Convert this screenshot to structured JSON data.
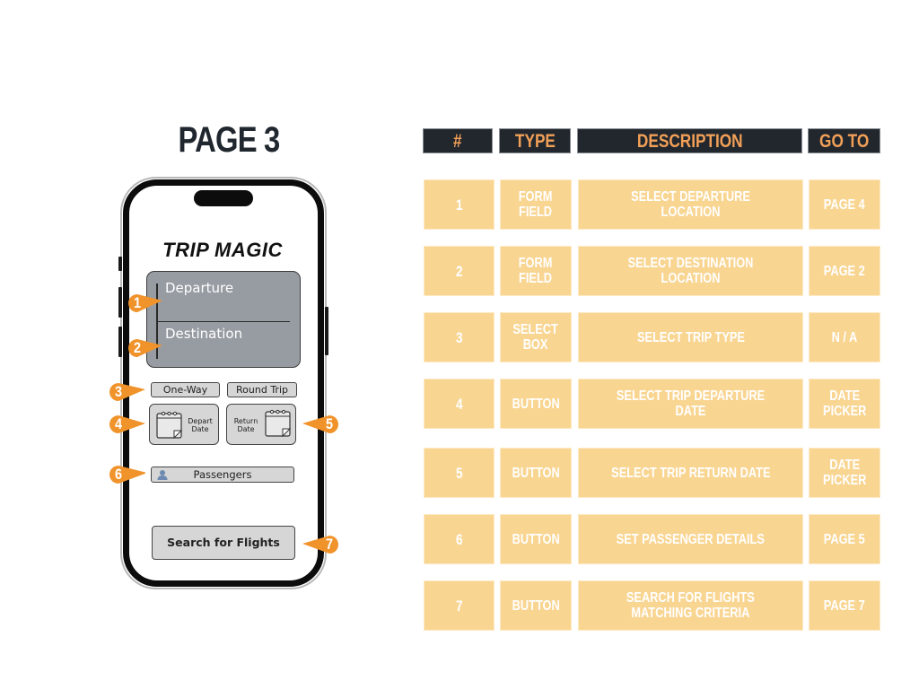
{
  "page_title": "PAGE 3",
  "phone": {
    "app_title": "TRIP MAGIC",
    "departure_label": "Departure",
    "destination_label": "Destination",
    "one_way_label": "One-Way",
    "round_trip_label": "Round Trip",
    "depart_date_label": "Depart\nDate",
    "return_date_label": "Return\nDate",
    "passengers_label": "Passengers",
    "search_label": "Search for Flights"
  },
  "markers": [
    "1",
    "2",
    "3",
    "4",
    "5",
    "6",
    "7"
  ],
  "colors": {
    "marker_orange": "#f0932b",
    "header_bg": "#22272e",
    "header_text": "#f2a057",
    "row_bg": "#f9d592",
    "panel_gray": "#979ca3"
  },
  "table": {
    "headers": [
      "#",
      "TYPE",
      "DESCRIPTION",
      "GO TO"
    ],
    "rows": [
      {
        "num": "1",
        "type": "FORM\nFIELD",
        "description": "SELECT DEPARTURE LOCATION",
        "goto": "PAGE 4"
      },
      {
        "num": "2",
        "type": "FORM\nFIELD",
        "description": "SELECT DESTINATION LOCATION",
        "goto": "PAGE 2"
      },
      {
        "num": "3",
        "type": "SELECT\nBOX",
        "description": "SELECT TRIP TYPE",
        "goto": "N / A"
      },
      {
        "num": "4",
        "type": "BUTTON",
        "description": "SELECT  TRIP DEPARTURE DATE",
        "goto": "DATE\nPICKER"
      },
      {
        "num": "5",
        "type": "BUTTON",
        "description": "SELECT  TRIP RETURN DATE",
        "goto": "DATE\nPICKER"
      },
      {
        "num": "6",
        "type": "BUTTON",
        "description": "SET PASSENGER DETAILS",
        "goto": "PAGE 5"
      },
      {
        "num": "7",
        "type": "BUTTON",
        "description": "SEARCH FOR FLIGHTS\nMATCHING CRITERIA",
        "goto": "PAGE 7"
      }
    ]
  }
}
